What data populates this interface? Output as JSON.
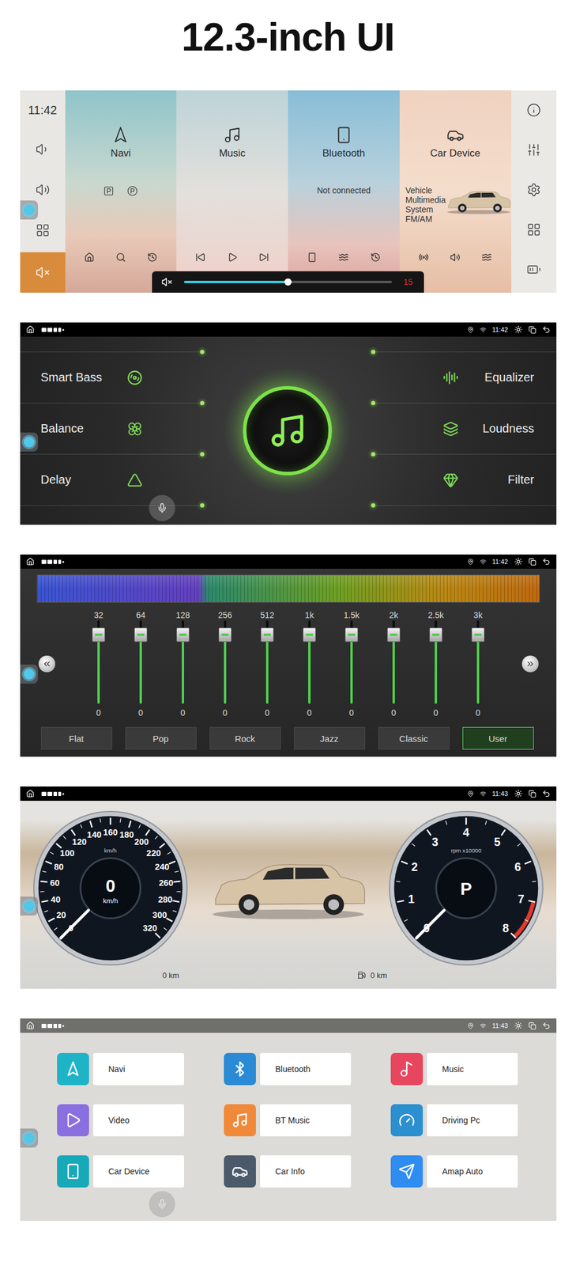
{
  "title": "12.3-inch UI",
  "home": {
    "time": "11:42",
    "cards": [
      {
        "kind": "navi",
        "label": "Navi",
        "lines": []
      },
      {
        "kind": "music",
        "label": "Music",
        "lines": []
      },
      {
        "kind": "bluetooth",
        "label": "Bluetooth",
        "lines": [
          "Not connected"
        ]
      },
      {
        "kind": "car",
        "label": "Car Device",
        "lines": [
          "Vehicle",
          "Multimedia",
          "System",
          "FM/AM"
        ]
      }
    ],
    "mute": {
      "selected": true
    },
    "volume": {
      "level": 0.5,
      "reading": "15"
    }
  },
  "audio": {
    "time": "11:42",
    "left": [
      {
        "label": "Smart Bass"
      },
      {
        "label": "Balance"
      },
      {
        "label": "Delay"
      }
    ],
    "right": [
      {
        "label": "Equalizer"
      },
      {
        "label": "Loudness"
      },
      {
        "label": "Filter"
      }
    ]
  },
  "equalizer": {
    "time": "11:42",
    "bands": [
      {
        "freq": "32",
        "value": "0",
        "level": 0.83
      },
      {
        "freq": "64",
        "value": "0",
        "level": 0.83
      },
      {
        "freq": "128",
        "value": "0",
        "level": 0.83
      },
      {
        "freq": "256",
        "value": "0",
        "level": 0.83
      },
      {
        "freq": "512",
        "value": "0",
        "level": 0.83
      },
      {
        "freq": "1k",
        "value": "0",
        "level": 0.83
      },
      {
        "freq": "1.5k",
        "value": "0",
        "level": 0.83
      },
      {
        "freq": "2k",
        "value": "0",
        "level": 0.83
      },
      {
        "freq": "2.5k",
        "value": "0",
        "level": 0.83
      },
      {
        "freq": "3k",
        "value": "0",
        "level": 0.83
      }
    ],
    "presets": [
      {
        "label": "Flat",
        "selected": false
      },
      {
        "label": "Pop",
        "selected": false
      },
      {
        "label": "Rock",
        "selected": false
      },
      {
        "label": "Jazz",
        "selected": false
      },
      {
        "label": "Classic",
        "selected": false
      },
      {
        "label": "User",
        "selected": true
      }
    ]
  },
  "dashboard": {
    "time": "11:43",
    "speed": {
      "ticks": [
        "0",
        "20",
        "40",
        "60",
        "80",
        "100",
        "120",
        "140",
        "160",
        "180",
        "200",
        "220",
        "240",
        "260",
        "280",
        "300",
        "320"
      ],
      "dial_unit": "km/h",
      "reading": "0",
      "unit": "km/h",
      "level": 0
    },
    "rpm": {
      "ticks": [
        "0",
        "1",
        "2",
        "3",
        "4",
        "5",
        "6",
        "7",
        "8"
      ],
      "dial_unit": "rpm x10000",
      "gear": "P",
      "level": 0,
      "redline_level": 0.875
    },
    "odometer": "0 km",
    "range": "0 km"
  },
  "apps": {
    "time": "11:43",
    "items": [
      {
        "label": "Navi",
        "color": "#1fb3c8"
      },
      {
        "label": "Bluetooth",
        "color": "#2a8ad6"
      },
      {
        "label": "Music",
        "color": "#e8455e"
      },
      {
        "label": "Video",
        "color": "#8a6fe0"
      },
      {
        "label": "BT Music",
        "color": "#f0893a"
      },
      {
        "label": "Driving Pc",
        "color": "#2b8fd0"
      },
      {
        "label": "Car Device",
        "color": "#18a9b8"
      },
      {
        "label": "Car Info",
        "color": "#4b5a6a"
      },
      {
        "label": "Amap Auto",
        "color": "#2f8cf0"
      }
    ]
  }
}
